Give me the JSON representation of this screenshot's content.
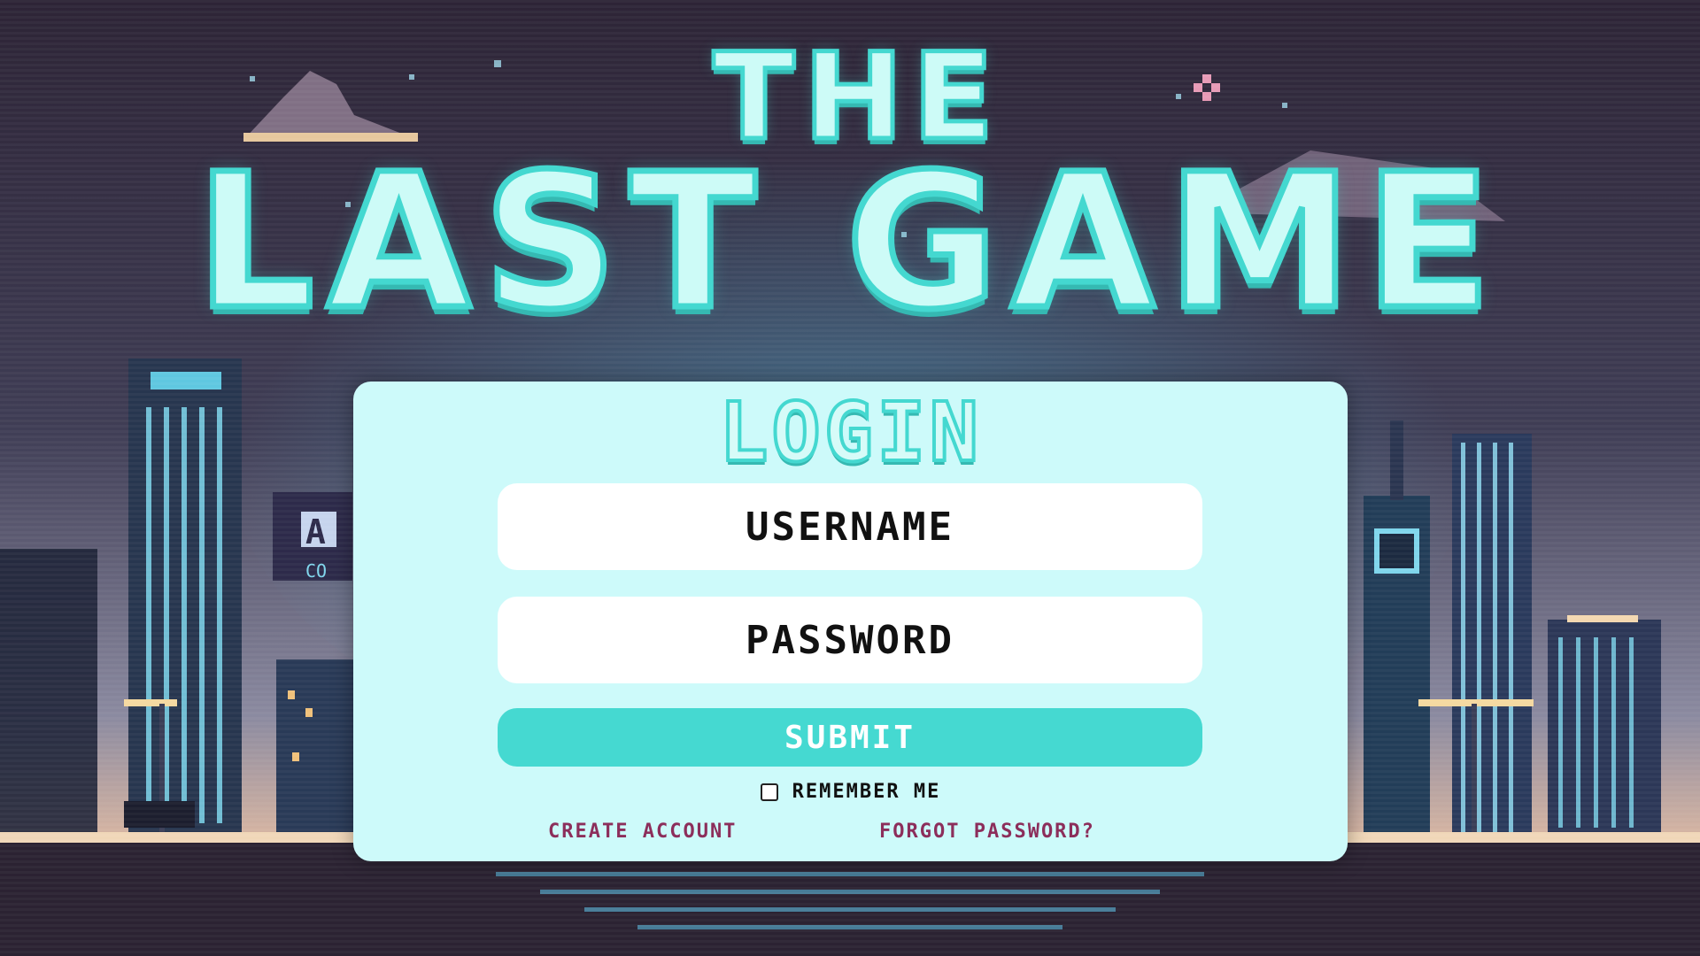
{
  "title": {
    "line1": "THE",
    "line2": "LAST GAME"
  },
  "login": {
    "heading": "LOGIN",
    "username_placeholder": "USERNAME",
    "password_placeholder": "PASSWORD",
    "submit_label": "SUBMIT",
    "remember_label": "REMEMBER ME",
    "remember_checked": false,
    "create_account_label": "CREATE ACCOUNT",
    "forgot_password_label": "FORGOT PASSWORD?"
  },
  "background": {
    "sign_letter": "A",
    "sign_text": "CO"
  },
  "colors": {
    "accent": "#45d9d1",
    "card": "#cdfafa",
    "link": "#8c2e5b",
    "background": "#2b2233"
  }
}
